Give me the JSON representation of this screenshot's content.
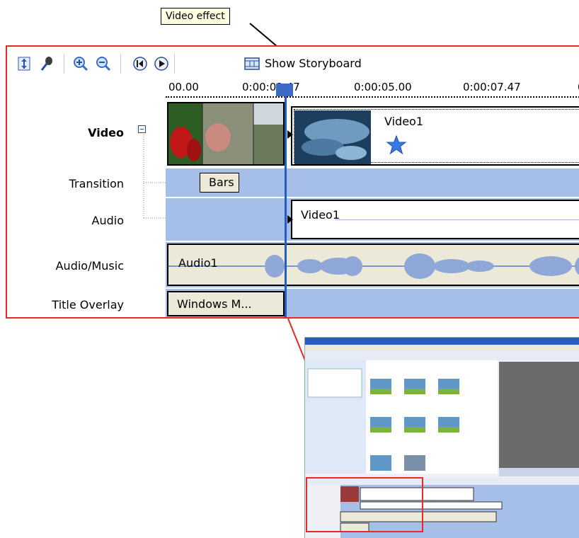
{
  "callout": {
    "text": "Video effect"
  },
  "toolbar": {
    "storyboard_label": "Show Storyboard",
    "buttons": [
      "timeline-narration-icon",
      "microphone-icon",
      "zoom-in-icon",
      "zoom-out-icon",
      "rewind-icon",
      "play-icon",
      "storyboard-icon"
    ]
  },
  "ruler": {
    "ticks": [
      "00.00",
      "0:00:02.47",
      "0:00:05.00",
      "0:00:07.47",
      "0"
    ]
  },
  "tracks": {
    "video": "Video",
    "transition": "Transition",
    "audio": "Audio",
    "audio_music": "Audio/Music",
    "title_overlay": "Title Overlay"
  },
  "clips": {
    "video_clip": "Video1",
    "transition_clip": "Bars",
    "audio_clip": "Video1",
    "music_clip": "Audio1",
    "title_clip": "Windows M..."
  },
  "colors": {
    "track_blue": "#a5bfe9",
    "frame_red": "#e8282a",
    "callout_bg": "#ffffe1",
    "playhead": "#1f5fc4"
  }
}
